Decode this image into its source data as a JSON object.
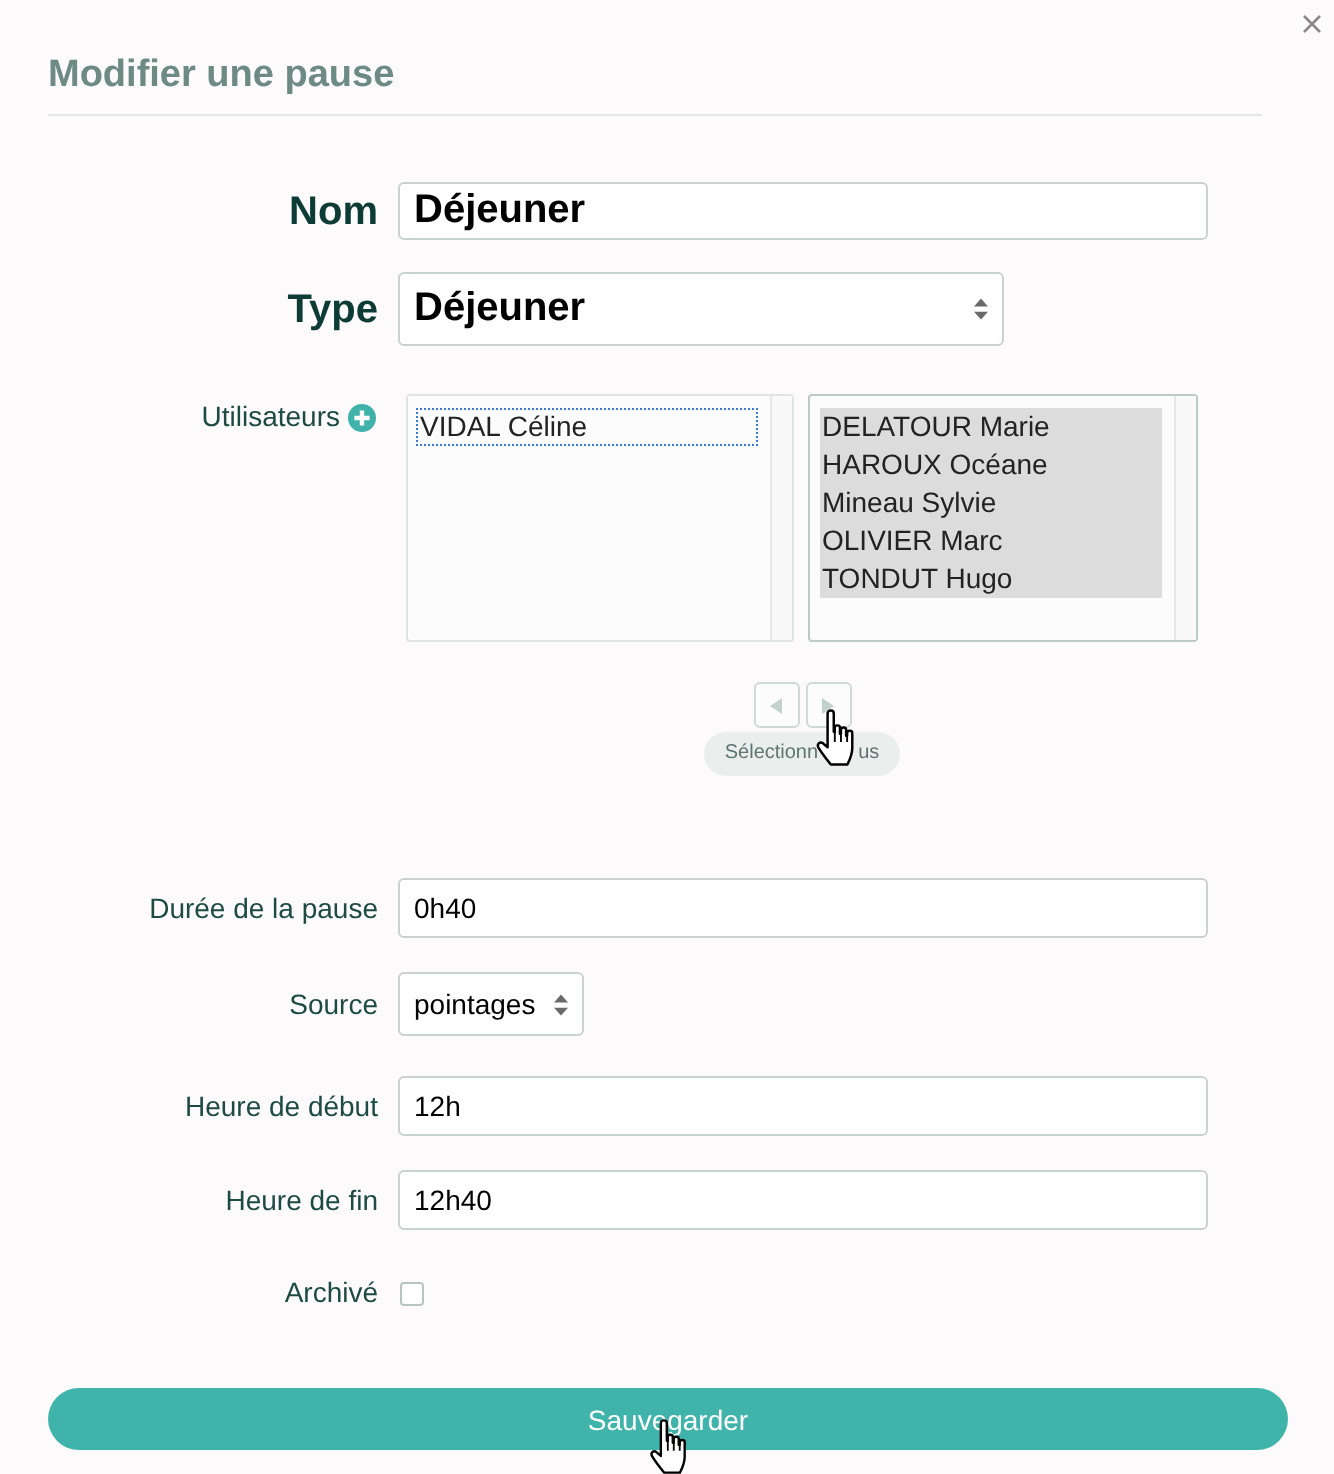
{
  "dialog": {
    "title": "Modifier une pause"
  },
  "main_fields": [
    {
      "kind": "text",
      "label": "Nom",
      "value": "Déjeuner"
    },
    {
      "kind": "select",
      "label": "Type",
      "value": "Déjeuner"
    }
  ],
  "users": {
    "label": "Utilisateurs",
    "available": [
      {
        "name": "VIDAL Céline",
        "selected": false,
        "focused": true
      }
    ],
    "chosen": [
      {
        "name": "DELATOUR Marie",
        "selected": true,
        "focused": false
      },
      {
        "name": "HAROUX Océane",
        "selected": true,
        "focused": false
      },
      {
        "name": "Mineau Sylvie",
        "selected": true,
        "focused": false
      },
      {
        "name": "OLIVIER Marc",
        "selected": true,
        "focused": false
      },
      {
        "name": "TONDUT Hugo",
        "selected": true,
        "focused": false
      }
    ],
    "tooltip": [
      "Sélectionn",
      "us"
    ]
  },
  "settings": [
    {
      "kind": "text",
      "label": "Durée de la pause",
      "value": "0h40"
    },
    {
      "kind": "select",
      "label": "Source",
      "value": "pointages"
    },
    {
      "kind": "text",
      "label": "Heure de début",
      "value": "12h"
    },
    {
      "kind": "text",
      "label": "Heure de fin",
      "value": "12h40"
    },
    {
      "kind": "checkbox",
      "label": "Archivé",
      "checked": false
    }
  ],
  "save_button": "Sauvegarder"
}
